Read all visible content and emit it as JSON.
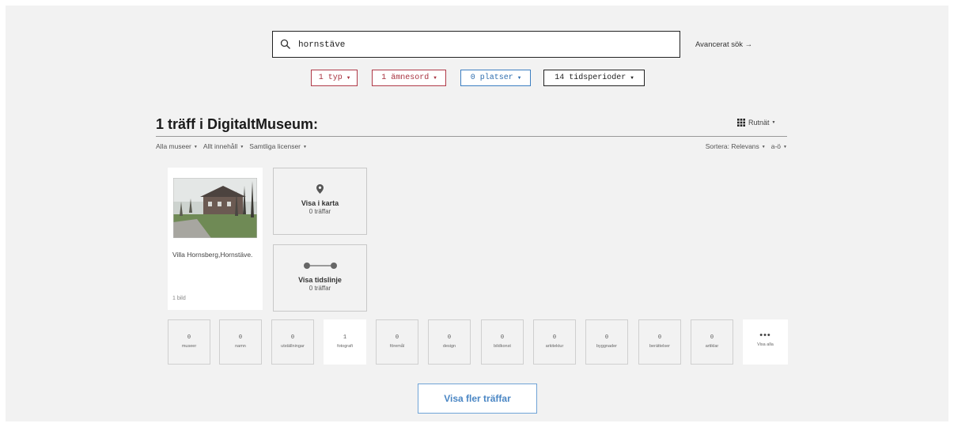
{
  "search": {
    "value": "hornstäve"
  },
  "advanced_search": "Avancerat sök →",
  "filters": [
    {
      "label": "1 typ",
      "color": "#a8323f"
    },
    {
      "label": "1 ämnesord",
      "color": "#a8323f"
    },
    {
      "label": "0 platser",
      "color": "#2f6eaf"
    },
    {
      "label": "14 tidsperioder",
      "color": "#222222"
    }
  ],
  "results": {
    "heading": "1 träff i DigitaltMuseum:",
    "view_label": "Rutnät",
    "sub_filters": [
      "Alla museer",
      "Allt innehåll",
      "Samtliga licenser"
    ],
    "sort_label": "Sortera: Relevans",
    "sort_order": "a-ö"
  },
  "card": {
    "title": "Villa Hornsberg,Hornstäve.",
    "count": "1 bild"
  },
  "map_box": {
    "label": "Visa i karta",
    "sub": "0 träffar",
    "icon": "map-pin-icon"
  },
  "timeline_box": {
    "label": "Visa tidslinje",
    "sub": "0 träffar",
    "icon": "timeline-icon"
  },
  "categories": [
    {
      "num": "0",
      "label": "museer"
    },
    {
      "num": "0",
      "label": "namn"
    },
    {
      "num": "0",
      "label": "utställningar"
    },
    {
      "num": "1",
      "label": "fotografi",
      "active": true
    },
    {
      "num": "0",
      "label": "föremål"
    },
    {
      "num": "0",
      "label": "design"
    },
    {
      "num": "0",
      "label": "bildkonst"
    },
    {
      "num": "0",
      "label": "arkitektur"
    },
    {
      "num": "0",
      "label": "byggnader"
    },
    {
      "num": "0",
      "label": "berättelser"
    },
    {
      "num": "0",
      "label": "artiklar"
    }
  ],
  "show_all": {
    "dots": "•••",
    "label": "Visa alla"
  },
  "more_button": "Visa fler träffar",
  "colors": {
    "accent_red": "#a8323f",
    "accent_blue": "#2f6eaf",
    "panel_bg": "#f2f2f2",
    "button_blue": "#4a86c4"
  }
}
